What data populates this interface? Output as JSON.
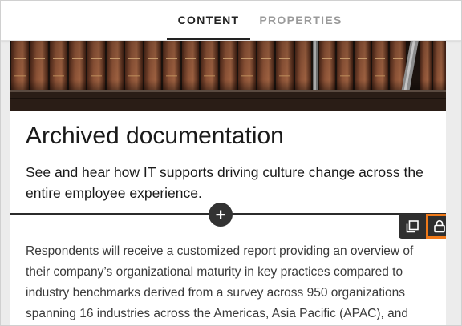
{
  "tabs": [
    {
      "label": "CONTENT",
      "active": true
    },
    {
      "label": "PROPERTIES",
      "active": false
    }
  ],
  "card": {
    "title": "Archived documentation",
    "subtitle": "See and hear how IT supports driving culture change across the entire employee experience.",
    "body": "Respondents will receive a customized report providing an overview of their company’s organizational maturity in key practices compared to industry benchmarks derived from a survey across 950 organizations spanning 16 industries across the Americas, Asia Pacific (APAC), and"
  },
  "icons": {
    "add": "plus-icon",
    "duplicate": "duplicate-icon",
    "lock": "lock-icon"
  },
  "colors": {
    "accent_highlight": "#f07a1a",
    "toolbar_bg": "#2f2f2f",
    "active_tab": "#222222",
    "inactive_tab": "#9a9a9a"
  }
}
